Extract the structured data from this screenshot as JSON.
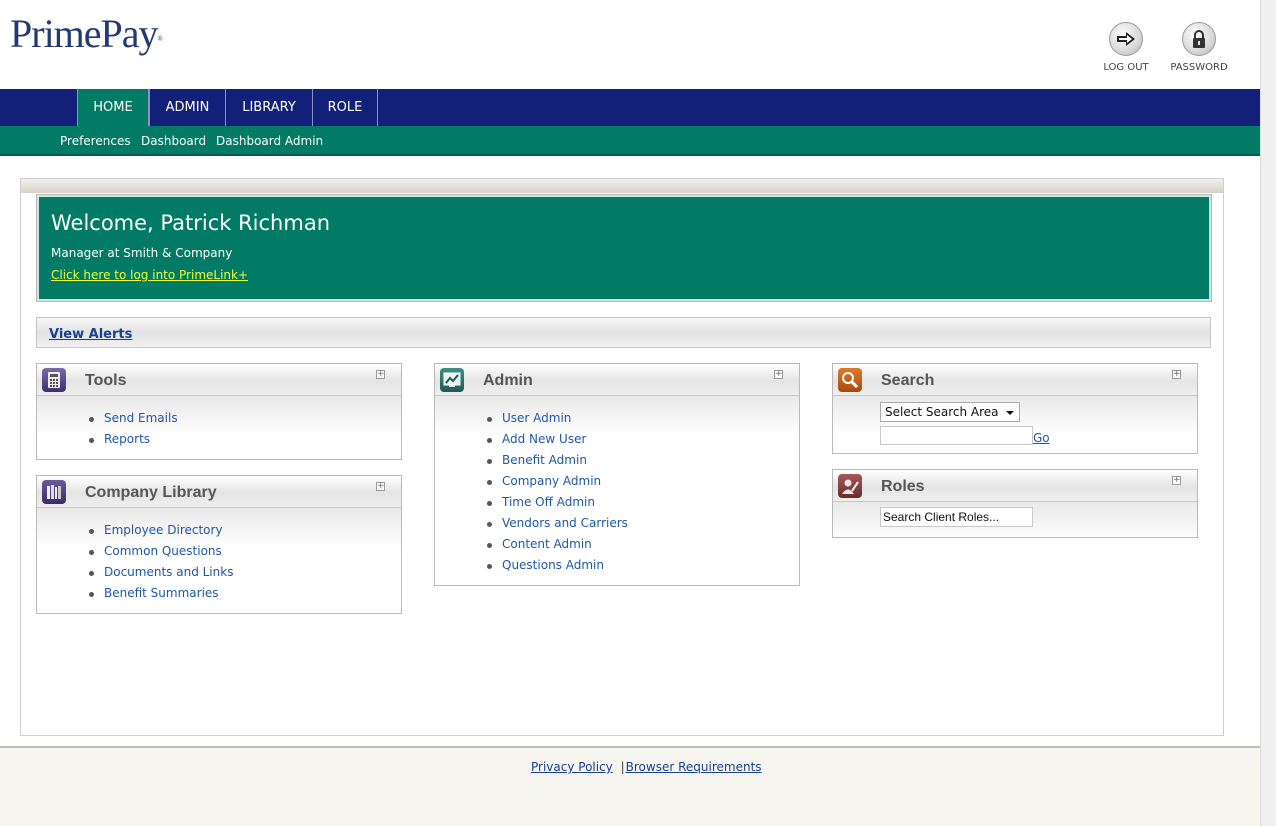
{
  "header": {
    "logo_text": "PrimePay",
    "logo_mark": "®",
    "logout_label": "LOG OUT",
    "password_label": "PASSWORD"
  },
  "nav": {
    "tabs": [
      {
        "label": "HOME",
        "active": true
      },
      {
        "label": "ADMIN"
      },
      {
        "label": "LIBRARY"
      },
      {
        "label": "ROLE"
      }
    ],
    "subnav": [
      "Preferences",
      "Dashboard",
      "Dashboard Admin"
    ]
  },
  "welcome": {
    "title": "Welcome, Patrick Richman",
    "role": "Manager at Smith & Company",
    "link": "Click here to log into PrimeLink+"
  },
  "alerts": {
    "link": "View Alerts"
  },
  "widgets": {
    "tools": {
      "title": "Tools",
      "items": [
        "Send Emails",
        "Reports"
      ]
    },
    "library": {
      "title": "Company Library",
      "items": [
        "Employee Directory",
        "Common Questions",
        "Documents and Links",
        "Benefit Summaries"
      ]
    },
    "admin": {
      "title": "Admin",
      "items": [
        "User Admin",
        "Add New User",
        "Benefit Admin",
        "Company Admin",
        "Time Off Admin",
        "Vendors and Carriers",
        "Content Admin",
        "Questions Admin"
      ]
    },
    "search": {
      "title": "Search",
      "select_value": "Select Search Area",
      "go_label": "Go"
    },
    "roles": {
      "title": "Roles",
      "input_value": "Search Client Roles..."
    },
    "toggle_glyph": "+"
  },
  "footer": {
    "privacy": "Privacy Policy",
    "separator": "|",
    "browser": "Browser Requirements"
  },
  "colors": {
    "nav": "#13207a",
    "accent_green": "#017a66",
    "link": "#1f57a8",
    "welcome_link": "#eaff3a"
  }
}
